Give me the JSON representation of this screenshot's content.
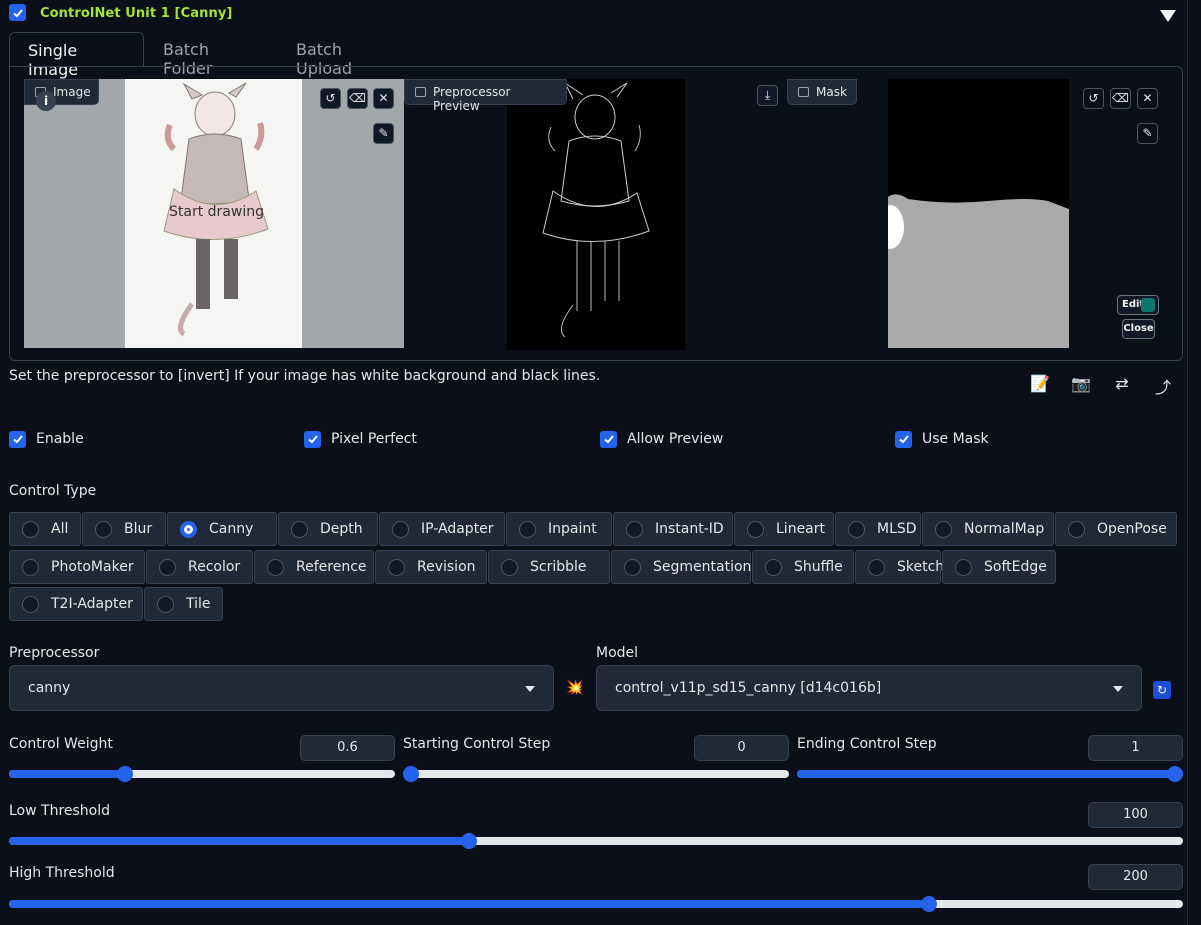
{
  "header": {
    "title": "ControlNet Unit 1  [Canny]"
  },
  "tabs": [
    {
      "label": "Single Image"
    },
    {
      "label": "Batch Folder"
    },
    {
      "label": "Batch Upload"
    }
  ],
  "image_panel": {
    "image_label": "Image",
    "canvas_text": "Start drawing",
    "preview_label": "Preprocessor Preview",
    "mask_label": "Mask",
    "edit_label": "Edit",
    "close_label": "Close"
  },
  "hint": "Set the preprocessor to [invert] If your image has white background and black lines.",
  "options": {
    "enable": "Enable",
    "pixel_perfect": "Pixel Perfect",
    "allow_preview": "Allow Preview",
    "use_mask": "Use Mask"
  },
  "control_type": {
    "label": "Control Type",
    "items": [
      "All",
      "Blur",
      "Canny",
      "Depth",
      "IP-Adapter",
      "Inpaint",
      "Instant-ID",
      "Lineart",
      "MLSD",
      "NormalMap",
      "OpenPose",
      "PhotoMaker",
      "Recolor",
      "Reference",
      "Revision",
      "Scribble",
      "Segmentation",
      "Shuffle",
      "Sketch",
      "SoftEdge",
      "T2I-Adapter",
      "Tile"
    ],
    "selected": "Canny"
  },
  "preprocessor": {
    "label": "Preprocessor",
    "value": "canny"
  },
  "model": {
    "label": "Model",
    "value": "control_v11p_sd15_canny [d14c016b]"
  },
  "sliders": {
    "control_weight": {
      "label": "Control Weight",
      "value": "0.6",
      "fraction": 0.3
    },
    "starting_step": {
      "label": "Starting Control Step",
      "value": "0",
      "fraction": 0
    },
    "ending_step": {
      "label": "Ending Control Step",
      "value": "1",
      "fraction": 1
    },
    "low_threshold": {
      "label": "Low Threshold",
      "value": "100",
      "fraction": 0.392
    },
    "high_threshold": {
      "label": "High Threshold",
      "value": "200",
      "fraction": 0.784
    }
  },
  "colors": {
    "accent": "#2563eb",
    "title": "#a3e635",
    "background": "#0b0f19"
  }
}
